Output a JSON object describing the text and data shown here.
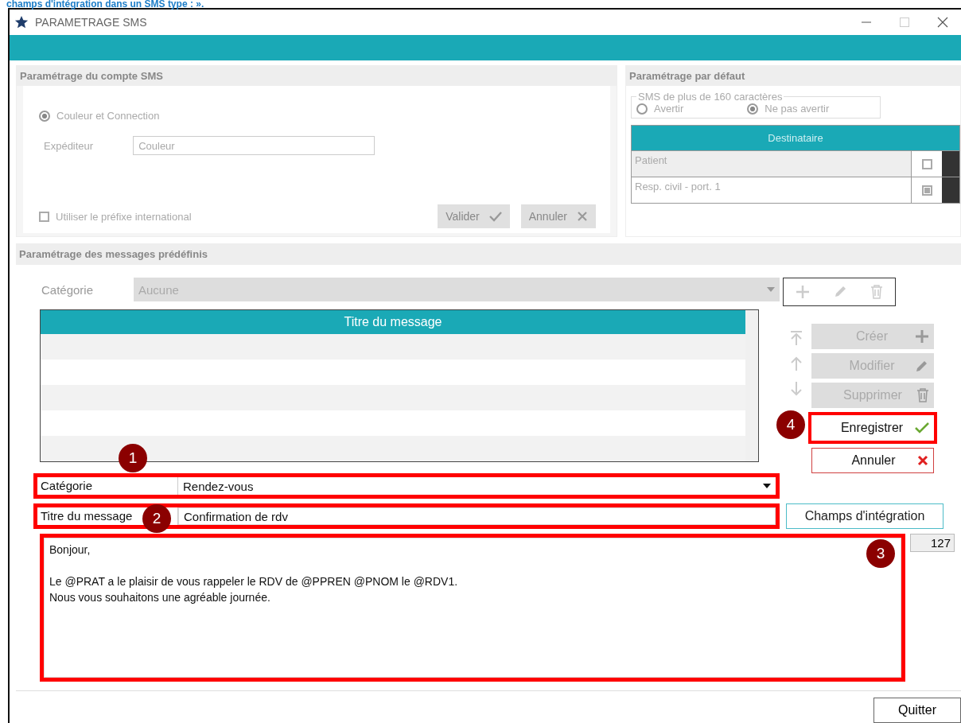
{
  "caption": "champs d'intégration dans un SMS type : ».",
  "window": {
    "title": "PARAMETRAGE SMS"
  },
  "account": {
    "heading": "Paramétrage du compte SMS",
    "option": {
      "label": "Couleur et Connection",
      "selected": true
    },
    "sender_label": "Expéditeur",
    "sender_value": "Couleur",
    "prefix": {
      "label": "Utiliser le préfixe international",
      "checked": false
    },
    "buttons": [
      {
        "label": "Valider",
        "kind": "confirm"
      },
      {
        "label": "Annuler",
        "kind": "cancel"
      }
    ]
  },
  "defaults": {
    "heading": "Paramétrage par défaut",
    "group_label": "SMS de plus de 160 caractères",
    "options": [
      {
        "label": "Avertir",
        "selected": false
      },
      {
        "label": "Ne pas avertir",
        "selected": true
      }
    ],
    "recipients_heading": "Destinataire",
    "recipients": [
      {
        "name": "Patient",
        "checked": false,
        "selected": true
      },
      {
        "name": "Resp. civil - port. 1",
        "checked": true,
        "selected": false
      }
    ]
  },
  "messages": {
    "heading": "Paramétrage des messages prédéfinis",
    "category_label": "Catégorie",
    "category_value": "Aucune",
    "table_column": "Titre du message",
    "side_buttons": [
      {
        "label": "Créer",
        "kind": "add",
        "disabled": true
      },
      {
        "label": "Modifier",
        "kind": "edit",
        "disabled": true
      },
      {
        "label": "Supprimer",
        "kind": "delete",
        "disabled": true
      },
      {
        "label": "Enregistrer",
        "kind": "save",
        "disabled": false,
        "annotation": "4"
      },
      {
        "label": "Annuler",
        "kind": "cancel",
        "disabled": false
      }
    ],
    "form_category_label": "Catégorie",
    "form_category_value": "Rendez-vous",
    "category_annotation": "1",
    "form_title_label": "Titre du message",
    "form_title_value": "Confirmation de rdv",
    "title_annotation": "2",
    "integration_button": "Champs d'intégration",
    "message_text": "Bonjour,\n\nLe @PRAT a le plaisir de vous rappeler le RDV de @PPREN @PNOM le @RDV1.\nNous vous souhaitons une agréable journée.",
    "message_annotation": "3",
    "counter": "127"
  },
  "quit_button": "Quitter"
}
